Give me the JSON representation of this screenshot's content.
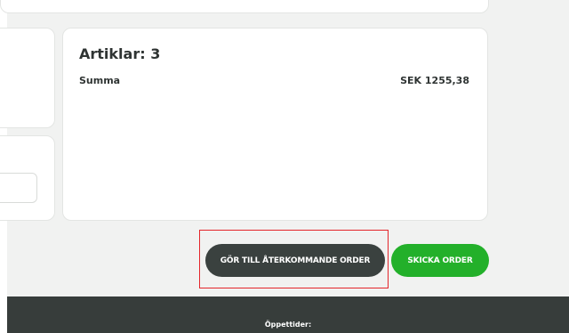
{
  "summary": {
    "title": "Artiklar: 3",
    "total_label": "Summa",
    "total_value": "SEK 1255,38"
  },
  "actions": {
    "recurring_label": "GÖR TILL ÅTERKOMMANDE ORDER",
    "send_label": "SKICKA ORDER"
  },
  "footer": {
    "hours_label": "Öppettider:"
  },
  "colors": {
    "accent_green": "#23b02a",
    "dark_button": "#3a413f",
    "footer_bg": "#373d3b",
    "highlight": "#e4262b"
  }
}
